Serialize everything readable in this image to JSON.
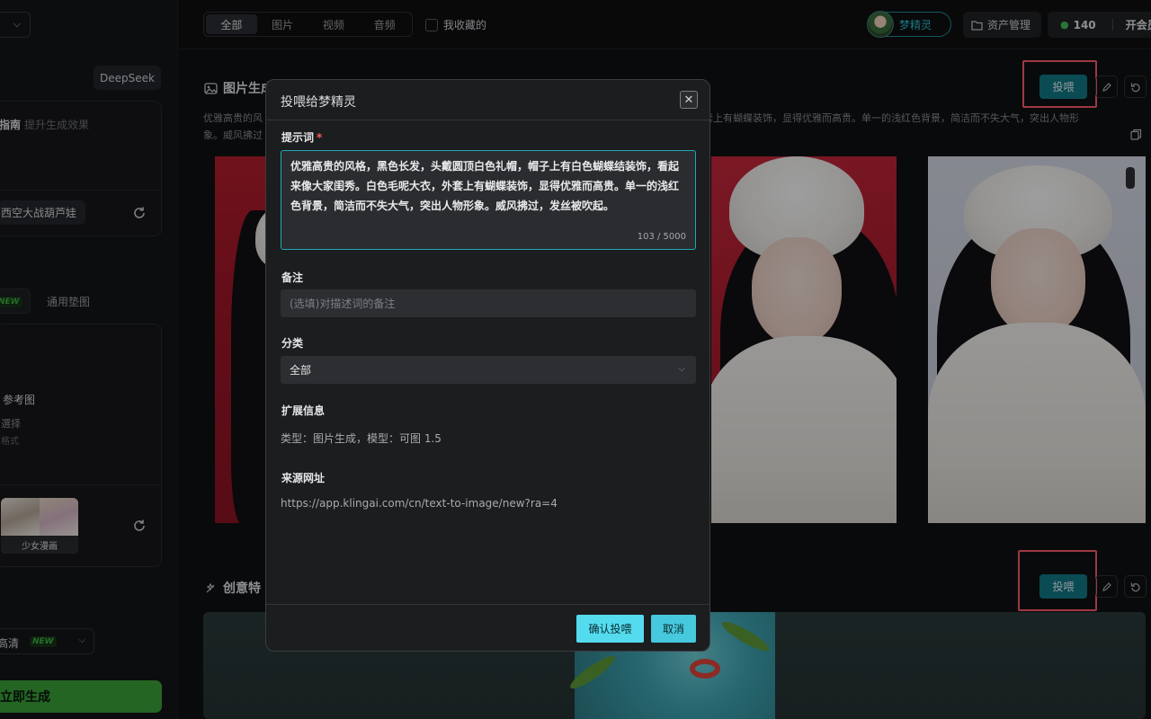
{
  "sidebar": {
    "model_label": "DeepSeek",
    "guide_title": "指南",
    "guide_hint": "提升生成效果",
    "prompt_tag": "西空大战葫芦娃",
    "tab_generic": "通用垫图",
    "new_badge": "NEW",
    "ref_label": "参考图",
    "ref_select": "選择",
    "ref_format": "格式",
    "style_thumb_label": "少女漫画",
    "hd_select": "高清",
    "generate_button": "立即生成"
  },
  "topbar": {
    "tabs": [
      "全部",
      "图片",
      "视频",
      "音频"
    ],
    "favorites_label": "我收藏的",
    "username": "梦精灵",
    "asset_button": "资产管理",
    "credits": "140",
    "membership": "开会员"
  },
  "main": {
    "section1_title": "图片生成",
    "section1_desc_line1": "优雅高贵的风",
    "section1_desc_right": "，外套上有蝴蝶装饰，显得优雅而高贵。单一的浅红色背景，简洁而不失大气，突出人物形",
    "section1_desc_line2": "象。威风拂过",
    "section2_title": "创意特",
    "feed_button": "投喂"
  },
  "modal": {
    "title": "投喂给梦精灵",
    "close": "✕",
    "prompt_label": "提示词",
    "required_mark": "*",
    "prompt_text": "优雅高贵的风格，黑色长发，头戴圆顶白色礼帽，帽子上有白色蝴蝶结装饰，看起来像大家闺秀。白色毛呢大衣，外套上有蝴蝶装饰，显得优雅而高贵。单一的浅红色背景，简洁而不失大气，突出人物形象。威风拂过，发丝被吹起。",
    "prompt_counter": "103 / 5000",
    "note_label": "备注",
    "note_placeholder": "(选填)对描述词的备注",
    "category_label": "分类",
    "category_value": "全部",
    "ext_label": "扩展信息",
    "ext_value": "类型：图片生成，模型：可图 1.5",
    "source_label": "来源网址",
    "source_value": "https://app.klingai.com/cn/text-to-image/new?ra=4",
    "confirm_button": "确认投喂",
    "cancel_button": "取消"
  },
  "colors": {
    "accent": "#127988",
    "highlight": "#ff5c6e",
    "generate": "#3aa33a",
    "modal_confirm": "#54dbee"
  }
}
